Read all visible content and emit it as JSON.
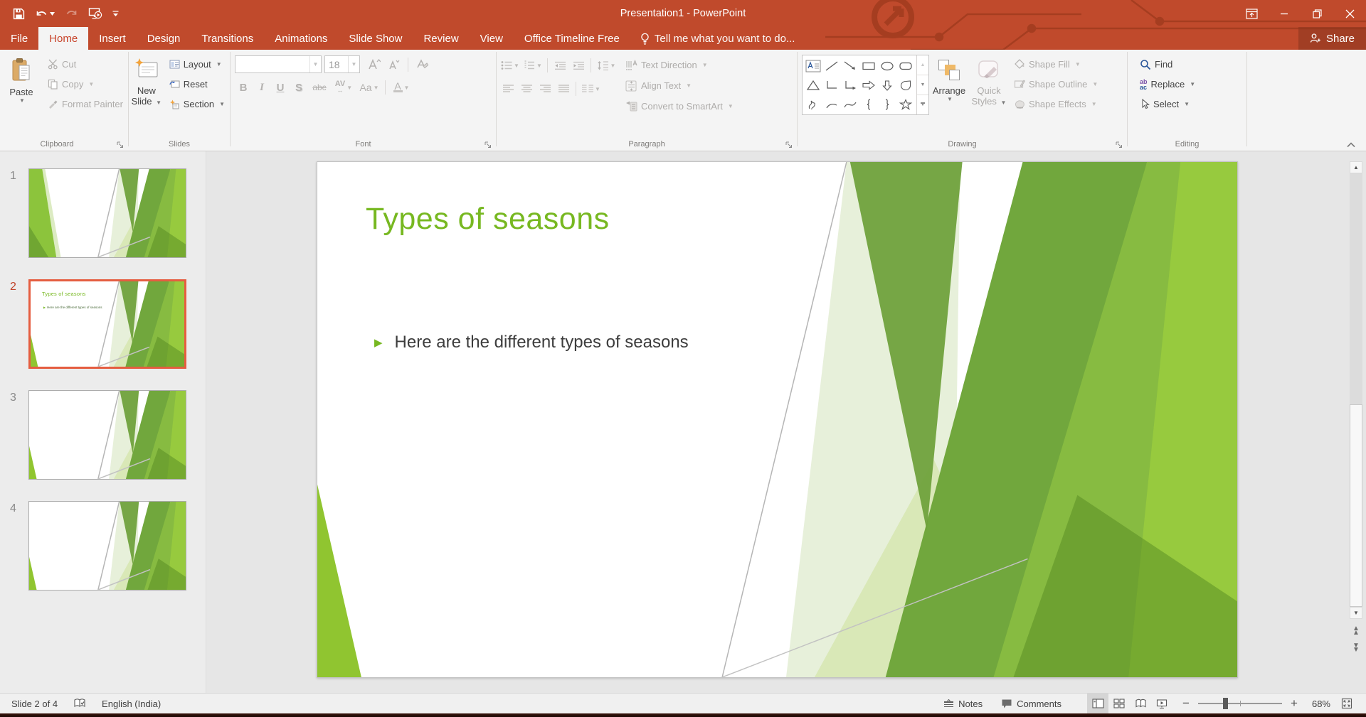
{
  "colors": {
    "titlebar_red": "#c04a2c",
    "active_tab_text": "#c8432a",
    "accent_green": "#77b821",
    "selection_orange": "#e55d40",
    "ribbon_bg": "#f4f4f4",
    "workspace_bg": "#e6e6e6",
    "disabled_text": "#aeacaa"
  },
  "title_bar": {
    "title": "Presentation1 - PowerPoint",
    "share_label": "Share",
    "qat_icons": [
      "save-icon",
      "undo-icon",
      "redo-icon",
      "start-slideshow-icon",
      "customize-quick-access-icon"
    ],
    "window_icons": [
      "ribbon-display-options-icon",
      "minimize-icon",
      "restore-icon",
      "close-icon"
    ]
  },
  "tabs": {
    "items": [
      {
        "label": "File"
      },
      {
        "label": "Home"
      },
      {
        "label": "Insert"
      },
      {
        "label": "Design"
      },
      {
        "label": "Transitions"
      },
      {
        "label": "Animations"
      },
      {
        "label": "Slide Show"
      },
      {
        "label": "Review"
      },
      {
        "label": "View"
      },
      {
        "label": "Office Timeline Free"
      }
    ],
    "active_tab": "Home",
    "tell_me": "Tell me what you want to do..."
  },
  "ribbon": {
    "clipboard": {
      "label": "Clipboard",
      "paste": "Paste",
      "cut": "Cut",
      "copy": "Copy",
      "format_painter": "Format Painter"
    },
    "slides": {
      "label": "Slides",
      "new_slide_1": "New",
      "new_slide_2": "Slide",
      "layout": "Layout",
      "reset": "Reset",
      "section": "Section"
    },
    "font": {
      "label": "Font",
      "size_value": "18",
      "bold": "B",
      "italic": "I",
      "underline": "U",
      "shadow": "S",
      "strike": "abc",
      "spacing": "AV",
      "case": "Aa",
      "color": "A"
    },
    "paragraph": {
      "label": "Paragraph",
      "text_direction": "Text Direction",
      "align_text": "Align Text",
      "smartart": "Convert to SmartArt"
    },
    "drawing": {
      "label": "Drawing",
      "arrange": "Arrange",
      "quick_styles_1": "Quick",
      "quick_styles_2": "Styles",
      "shape_fill": "Shape Fill",
      "shape_outline": "Shape Outline",
      "shape_effects": "Shape Effects",
      "shape_gallery": [
        "text-box",
        "line",
        "arrow",
        "rectangle",
        "oval",
        "rounded-rectangle",
        "triangle",
        "elbow-connector",
        "elbow-arrow-connector",
        "right-arrow-shape",
        "down-arrow-shape",
        "teardrop-shape",
        "scribble",
        "arc",
        "curve",
        "left-brace",
        "right-brace",
        "star"
      ]
    },
    "editing": {
      "label": "Editing",
      "find": "Find",
      "replace": "Replace",
      "select": "Select"
    }
  },
  "slides_panel": {
    "selected_slide": "2",
    "slides": [
      {
        "number": "1"
      },
      {
        "number": "2",
        "title": "Types of seasons",
        "bullet": "Here are the different types of seasons"
      },
      {
        "number": "3"
      },
      {
        "number": "4"
      }
    ]
  },
  "slide": {
    "title": "Types of seasons",
    "bullet": "Here are the different types of seasons"
  },
  "status_bar": {
    "slide_indicator": "Slide 2 of 4",
    "language": "English (India)",
    "notes_label": "Notes",
    "comments_label": "Comments",
    "zoom_level": "68%",
    "view_icons": [
      "normal-view-icon",
      "slide-sorter-icon",
      "reading-view-icon",
      "slideshow-icon"
    ]
  }
}
